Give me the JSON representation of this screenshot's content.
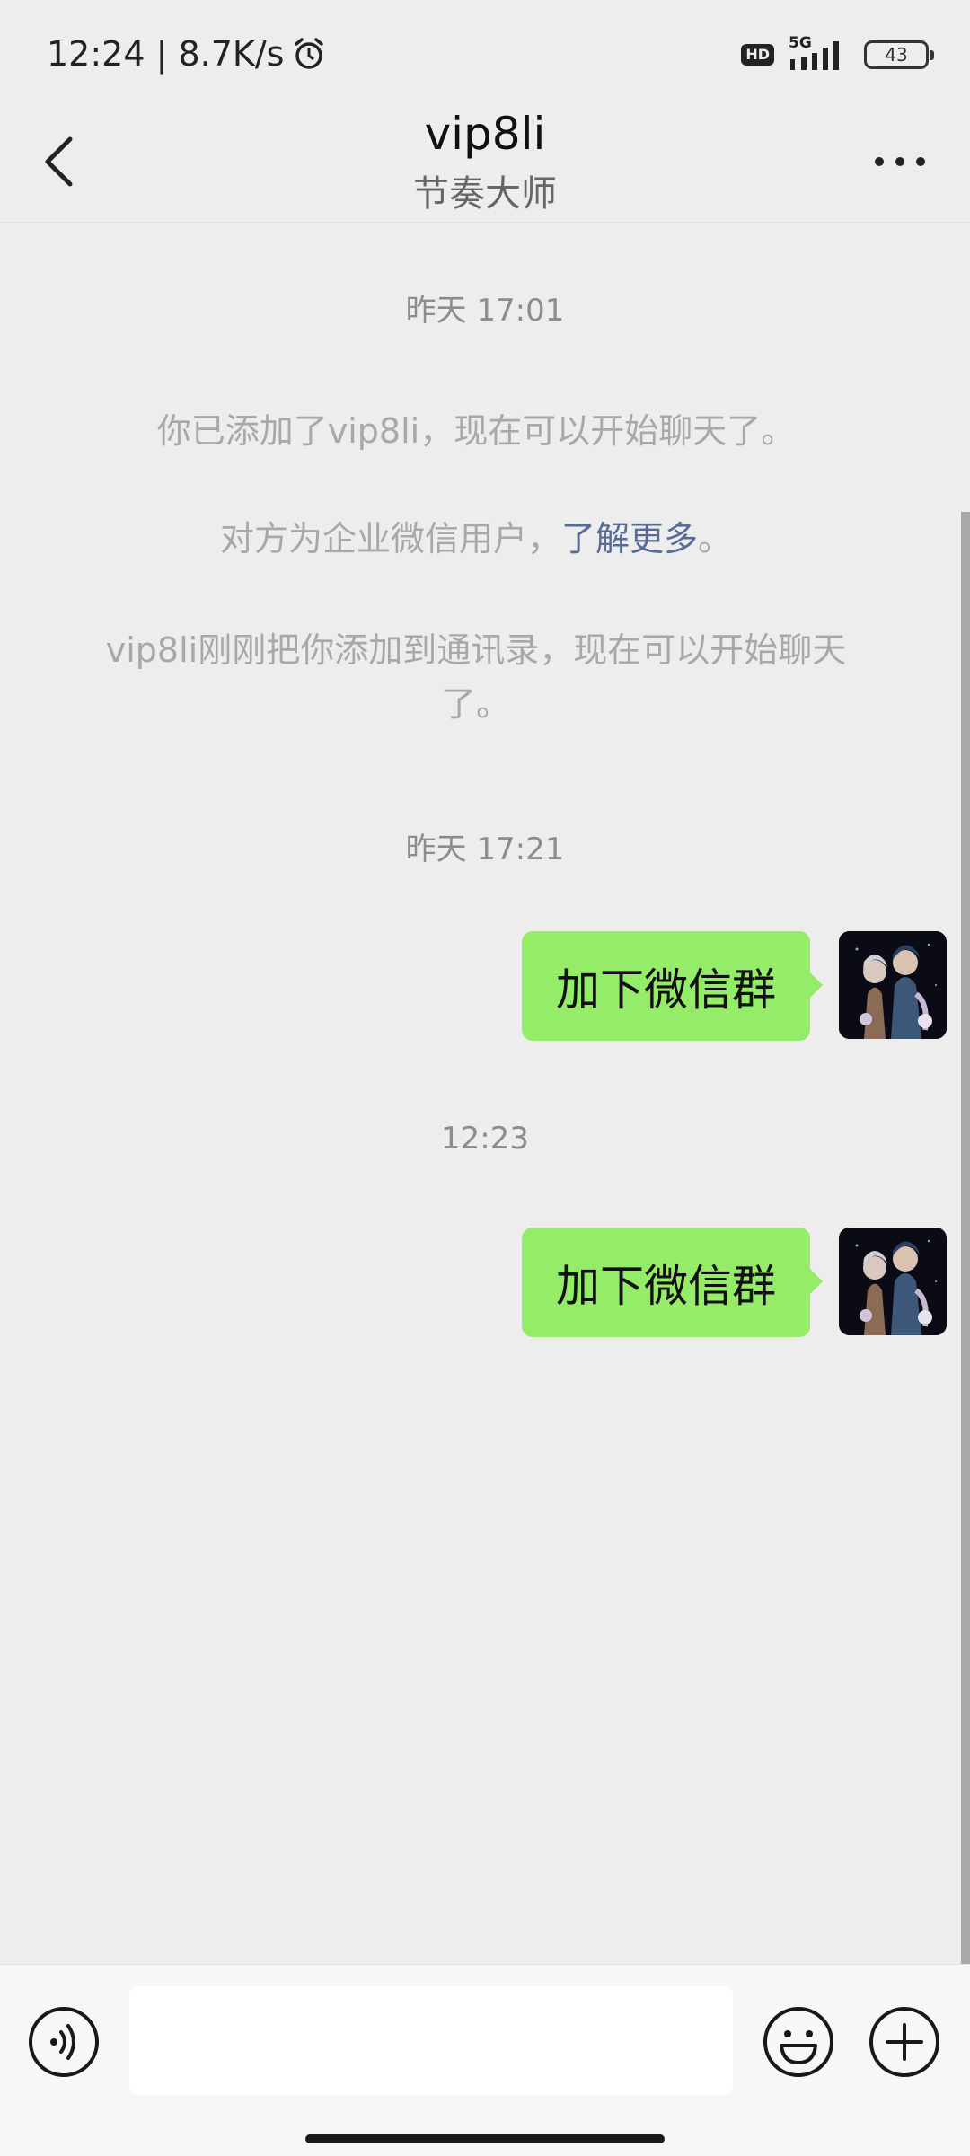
{
  "status_bar": {
    "left_text": "12:24 | 8.7K/s",
    "hd_label": "HD",
    "network_type": "5G",
    "battery_level": "43",
    "icons": [
      "alarm-icon",
      "signal-icon",
      "battery-icon"
    ]
  },
  "navbar": {
    "title": "vip8li",
    "subtitle": "节奏大师",
    "icons": [
      "back-arrow-icon",
      "more-dots-icon"
    ]
  },
  "messages": {
    "timestamp_1": "昨天 17:01",
    "system_1": "你已添加了vip8li，现在可以开始聊天了。",
    "system_2_prefix": "对方为企业微信用户，",
    "system_2_link": "了解更多",
    "system_2_suffix": "。",
    "system_3": "vip8li刚刚把你添加到通讯录，现在可以开始聊天了。",
    "timestamp_2": "昨天 17:21",
    "bubble_1": "加下微信群",
    "timestamp_3": "12:23",
    "bubble_2": "加下微信群"
  },
  "input_bar": {
    "text_value": "",
    "icons": [
      "voice-icon",
      "emoji-icon",
      "plus-icon"
    ]
  },
  "colors": {
    "background": "#ededed",
    "bubble_green": "#95ec69",
    "link_blue": "#576b95"
  }
}
